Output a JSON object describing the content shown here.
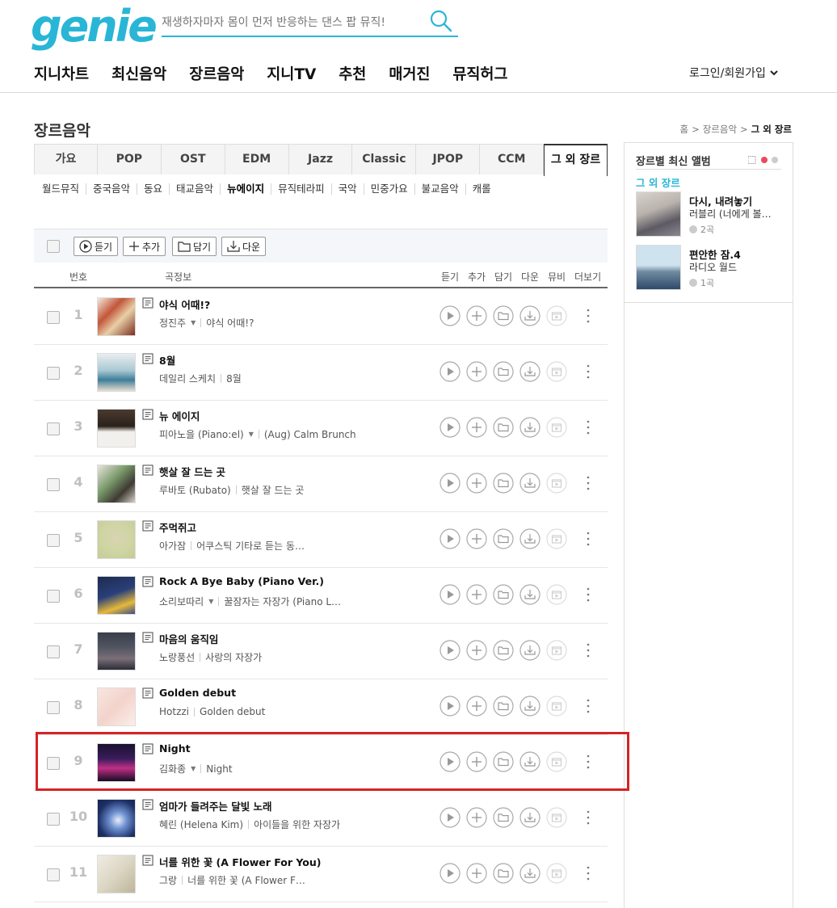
{
  "header": {
    "logo": "genie",
    "search_placeholder": "재생하자마자 몸이 먼저 반응하는 댄스 팝 뮤직!",
    "nav": [
      "지니차트",
      "최신음악",
      "장르음악",
      "지니TV",
      "추천",
      "매거진",
      "뮤직허그"
    ],
    "login": "로그인/회원가입"
  },
  "page": {
    "title": "장르음악",
    "breadcrumb": [
      "홈",
      "장르음악",
      "그 외 장르"
    ]
  },
  "genre_tabs": {
    "items": [
      "가요",
      "POP",
      "OST",
      "EDM",
      "Jazz",
      "Classic",
      "JPOP",
      "CCM",
      "그 외 장르"
    ],
    "active": "그 외 장르"
  },
  "sub_genres": {
    "items": [
      "월드뮤직",
      "중국음악",
      "동요",
      "태교음악",
      "뉴에이지",
      "뮤직테라피",
      "국악",
      "민중가요",
      "불교음악",
      "캐롤"
    ],
    "active": "뉴에이지"
  },
  "toolbar": {
    "play": "듣기",
    "add": "추가",
    "save": "담기",
    "download": "다운"
  },
  "list_header": {
    "num": "번호",
    "info": "곡정보",
    "play": "듣기",
    "add": "추가",
    "save": "담기",
    "download": "다운",
    "mv": "뮤비",
    "more": "더보기"
  },
  "songs": [
    {
      "num": "1",
      "title": "야식 어때!?",
      "artist": "정진주",
      "album": "야식 어때!?",
      "has_dropdown": true
    },
    {
      "num": "2",
      "title": "8월",
      "artist": "데일리 스케치",
      "album": "8월",
      "has_dropdown": false
    },
    {
      "num": "3",
      "title": "뉴 에이지",
      "artist": "피아노을 (Piano:el)",
      "album": "(Aug) Calm Brunch",
      "has_dropdown": true
    },
    {
      "num": "4",
      "title": "햇살 잘 드는 곳",
      "artist": "루바토 (Rubato)",
      "album": "햇살 잘 드는 곳",
      "has_dropdown": false
    },
    {
      "num": "5",
      "title": "주먹쥐고",
      "artist": "아가잠",
      "album": "어쿠스틱 기타로 듣는 동…",
      "has_dropdown": false
    },
    {
      "num": "6",
      "title": "Rock A Bye Baby (Piano Ver.)",
      "artist": "소리보따리",
      "album": "꿀잠자는 자장가 (Piano L…",
      "has_dropdown": true
    },
    {
      "num": "7",
      "title": "마음의 움직임",
      "artist": "노랑풍선",
      "album": "사랑의 자장가",
      "has_dropdown": false
    },
    {
      "num": "8",
      "title": "Golden debut",
      "artist": "Hotzzi",
      "album": "Golden debut",
      "has_dropdown": false
    },
    {
      "num": "9",
      "title": "Night",
      "artist": "김화종",
      "album": "Night",
      "has_dropdown": true
    },
    {
      "num": "10",
      "title": "엄마가 들려주는 달빛 노래",
      "artist": "혜린 (Helena Kim)",
      "album": "아이들을 위한 자장가",
      "has_dropdown": false
    },
    {
      "num": "11",
      "title": "너를 위한 꽃 (A Flower For You)",
      "artist": "그랑",
      "album": "너를 위한 꽃 (A Flower F…",
      "has_dropdown": false
    }
  ],
  "sidebar": {
    "title": "장르별 최신 앨범",
    "genre": "그 외 장르",
    "albums": [
      {
        "title": "다시, 내려놓기",
        "artist": "러블리 (너에게 볼…",
        "count": "2곡"
      },
      {
        "title": "편안한 잠.4",
        "artist": "라디오 월드",
        "count": "1곡"
      }
    ]
  },
  "colors": {
    "brand": "#29b6d6",
    "highlight": "#d62326",
    "sidebar_dot_active": "#e74c5a"
  }
}
